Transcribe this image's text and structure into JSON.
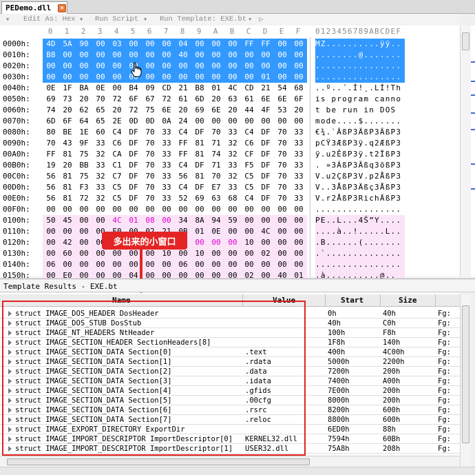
{
  "tab": {
    "title": "PEDemo.dll",
    "close_icon": "x"
  },
  "toolbar": {
    "edit_as": "Edit As: Hex",
    "run_script": "Run Script",
    "run_template": "Run Template: EXE.bt",
    "play_icon": "play-triangle"
  },
  "hex": {
    "columns": [
      "0",
      "1",
      "2",
      "3",
      "4",
      "5",
      "6",
      "7",
      "8",
      "9",
      "A",
      "B",
      "C",
      "D",
      "E",
      "F"
    ],
    "ascii_header": "0123456789ABCDEF",
    "rows": [
      {
        "offset": "0000h:",
        "bytes": [
          "4D",
          "5A",
          "90",
          "00",
          "03",
          "00",
          "00",
          "00",
          "04",
          "00",
          "00",
          "00",
          "FF",
          "FF",
          "00",
          "00"
        ],
        "ascii": "MZ..........ÿÿ.."
      },
      {
        "offset": "0010h:",
        "bytes": [
          "B8",
          "00",
          "00",
          "00",
          "00",
          "00",
          "00",
          "00",
          "40",
          "00",
          "00",
          "00",
          "00",
          "00",
          "00",
          "00"
        ],
        "ascii": ",.......@......."
      },
      {
        "offset": "0020h:",
        "bytes": [
          "00",
          "00",
          "00",
          "00",
          "00",
          "00",
          "00",
          "00",
          "00",
          "00",
          "00",
          "00",
          "00",
          "00",
          "00",
          "00"
        ],
        "ascii": "................"
      },
      {
        "offset": "0030h:",
        "bytes": [
          "00",
          "00",
          "00",
          "00",
          "00",
          "00",
          "00",
          "00",
          "00",
          "00",
          "00",
          "00",
          "00",
          "01",
          "00",
          "00"
        ],
        "ascii": "................"
      },
      {
        "offset": "0040h:",
        "bytes": [
          "0E",
          "1F",
          "BA",
          "0E",
          "00",
          "B4",
          "09",
          "CD",
          "21",
          "B8",
          "01",
          "4C",
          "CD",
          "21",
          "54",
          "68"
        ],
        "ascii": "..º..´.Í!¸.LÍ!Th"
      },
      {
        "offset": "0050h:",
        "bytes": [
          "69",
          "73",
          "20",
          "70",
          "72",
          "6F",
          "67",
          "72",
          "61",
          "6D",
          "20",
          "63",
          "61",
          "6E",
          "6E",
          "6F"
        ],
        "ascii": "is program canno"
      },
      {
        "offset": "0060h:",
        "bytes": [
          "74",
          "20",
          "62",
          "65",
          "20",
          "72",
          "75",
          "6E",
          "20",
          "69",
          "6E",
          "20",
          "44",
          "4F",
          "53",
          "20"
        ],
        "ascii": "t be run in DOS "
      },
      {
        "offset": "0070h:",
        "bytes": [
          "6D",
          "6F",
          "64",
          "65",
          "2E",
          "0D",
          "0D",
          "0A",
          "24",
          "00",
          "00",
          "00",
          "00",
          "00",
          "00",
          "00"
        ],
        "ascii": "mode....$......."
      },
      {
        "offset": "0080h:",
        "bytes": [
          "80",
          "BE",
          "1E",
          "60",
          "C4",
          "DF",
          "70",
          "33",
          "C4",
          "DF",
          "70",
          "33",
          "C4",
          "DF",
          "70",
          "33"
        ],
        "ascii": "€¾.`ÄßP3ÄßP3ÄßP3"
      },
      {
        "offset": "0090h:",
        "bytes": [
          "70",
          "43",
          "9F",
          "33",
          "C6",
          "DF",
          "70",
          "33",
          "FF",
          "81",
          "71",
          "32",
          "C6",
          "DF",
          "70",
          "33"
        ],
        "ascii": "pCŸ3ÆßP3ÿ.q2ÆßP3"
      },
      {
        "offset": "00A0h:",
        "bytes": [
          "FF",
          "81",
          "75",
          "32",
          "CA",
          "DF",
          "70",
          "33",
          "FF",
          "81",
          "74",
          "32",
          "CF",
          "DF",
          "70",
          "33"
        ],
        "ascii": "ÿ.u2ÊßP3ÿ.t2ÏßP3"
      },
      {
        "offset": "00B0h:",
        "bytes": [
          "19",
          "20",
          "BB",
          "33",
          "C1",
          "DF",
          "70",
          "33",
          "C4",
          "DF",
          "71",
          "33",
          "F5",
          "DF",
          "70",
          "33"
        ],
        "ascii": ". »3ÁßP3Äßq3õßP3"
      },
      {
        "offset": "00C0h:",
        "bytes": [
          "56",
          "81",
          "75",
          "32",
          "C7",
          "DF",
          "70",
          "33",
          "56",
          "81",
          "70",
          "32",
          "C5",
          "DF",
          "70",
          "33"
        ],
        "ascii": "V.u2ÇßP3V.p2ÅßP3"
      },
      {
        "offset": "00D0h:",
        "bytes": [
          "56",
          "81",
          "F3",
          "33",
          "C5",
          "DF",
          "70",
          "33",
          "C4",
          "DF",
          "E7",
          "33",
          "C5",
          "DF",
          "70",
          "33"
        ],
        "ascii": "V..3ÅßP3Äßç3ÅßP3"
      },
      {
        "offset": "00E0h:",
        "bytes": [
          "56",
          "81",
          "72",
          "32",
          "C5",
          "DF",
          "70",
          "33",
          "52",
          "69",
          "63",
          "68",
          "C4",
          "DF",
          "70",
          "33"
        ],
        "ascii": "V.r2ÅßP3RichÄßP3"
      },
      {
        "offset": "00F0h:",
        "bytes": [
          "00",
          "00",
          "00",
          "00",
          "00",
          "00",
          "00",
          "00",
          "00",
          "00",
          "00",
          "00",
          "00",
          "00",
          "00",
          "00"
        ],
        "ascii": "................"
      },
      {
        "offset": "0100h:",
        "bytes": [
          "50",
          "45",
          "00",
          "00",
          "4C",
          "01",
          "08",
          "00",
          "34",
          "8A",
          "94",
          "59",
          "00",
          "00",
          "00",
          "00"
        ],
        "ascii": "PE..L...4Š”Y...."
      },
      {
        "offset": "0110h:",
        "bytes": [
          "00",
          "00",
          "00",
          "00",
          "E0",
          "00",
          "02",
          "21",
          "0B",
          "01",
          "0E",
          "00",
          "00",
          "4C",
          "00",
          "00"
        ],
        "ascii": "....à..!.....L.."
      },
      {
        "offset": "0120h:",
        "bytes": [
          "00",
          "42",
          "00",
          "00",
          "00",
          "00",
          "00",
          "00",
          "10",
          "00",
          "00",
          "00",
          "10",
          "00",
          "00",
          "00"
        ],
        "ascii": ".B......(......."
      },
      {
        "offset": "0130h:",
        "bytes": [
          "00",
          "60",
          "00",
          "00",
          "00",
          "00",
          "00",
          "10",
          "00",
          "10",
          "00",
          "00",
          "00",
          "02",
          "00",
          "00"
        ],
        "ascii": ".`.............."
      },
      {
        "offset": "0140h:",
        "bytes": [
          "06",
          "00",
          "00",
          "00",
          "00",
          "00",
          "00",
          "00",
          "06",
          "00",
          "00",
          "00",
          "00",
          "00",
          "00",
          "00"
        ],
        "ascii": "................"
      },
      {
        "offset": "0150h:",
        "bytes": [
          "00",
          "E0",
          "00",
          "00",
          "00",
          "04",
          "00",
          "00",
          "00",
          "00",
          "00",
          "00",
          "02",
          "00",
          "40",
          "01"
        ],
        "ascii": ".à..........@.."
      }
    ]
  },
  "annotation": {
    "callout_text": "多出来的小窗口"
  },
  "template_panel": {
    "title": "Template Results - EXE.bt",
    "headers": {
      "name": "Name",
      "value": "Value",
      "start": "Start",
      "size": "Size"
    },
    "rows": [
      {
        "name": "struct IMAGE_DOS_HEADER DosHeader",
        "value": "",
        "start": "0h",
        "size": "40h",
        "extra": "Fg:"
      },
      {
        "name": "struct IMAGE_DOS_STUB DosStub",
        "value": "",
        "start": "40h",
        "size": "C0h",
        "extra": "Fg:"
      },
      {
        "name": "struct IMAGE_NT_HEADERS NtHeader",
        "value": "",
        "start": "100h",
        "size": "F8h",
        "extra": "Fg:"
      },
      {
        "name": "struct IMAGE_SECTION_HEADER SectionHeaders[8]",
        "value": "",
        "start": "1F8h",
        "size": "140h",
        "extra": "Fg:"
      },
      {
        "name": "struct IMAGE_SECTION_DATA Section[0]",
        "value": ".text",
        "start": "400h",
        "size": "4C00h",
        "extra": "Fg:"
      },
      {
        "name": "struct IMAGE_SECTION_DATA Section[1]",
        "value": ".rdata",
        "start": "5000h",
        "size": "2200h",
        "extra": "Fg:"
      },
      {
        "name": "struct IMAGE_SECTION_DATA Section[2]",
        "value": ".data",
        "start": "7200h",
        "size": "200h",
        "extra": "Fg:"
      },
      {
        "name": "struct IMAGE_SECTION_DATA Section[3]",
        "value": ".idata",
        "start": "7400h",
        "size": "A00h",
        "extra": "Fg:"
      },
      {
        "name": "struct IMAGE_SECTION_DATA Section[4]",
        "value": ".gfids",
        "start": "7E00h",
        "size": "200h",
        "extra": "Fg:"
      },
      {
        "name": "struct IMAGE_SECTION_DATA Section[5]",
        "value": ".00cfg",
        "start": "8000h",
        "size": "200h",
        "extra": "Fg:"
      },
      {
        "name": "struct IMAGE_SECTION_DATA Section[6]",
        "value": ".rsrc",
        "start": "8200h",
        "size": "600h",
        "extra": "Fg:"
      },
      {
        "name": "struct IMAGE_SECTION_DATA Section[7]",
        "value": ".reloc",
        "start": "8800h",
        "size": "600h",
        "extra": "Fg:"
      },
      {
        "name": "struct IMAGE_EXPORT_DIRECTORY ExportDir",
        "value": "",
        "start": "6ED0h",
        "size": "88h",
        "extra": "Fg:"
      },
      {
        "name": "struct IMAGE_IMPORT_DESCRIPTOR ImportDescriptor[0]",
        "value": "KERNEL32.dll",
        "start": "7594h",
        "size": "60Bh",
        "extra": "Fg:"
      },
      {
        "name": "struct IMAGE_IMPORT_DESCRIPTOR ImportDescriptor[1]",
        "value": "USER32.dll",
        "start": "75A8h",
        "size": "208h",
        "extra": "Fg:"
      }
    ]
  },
  "colors": {
    "selection": "#3399ff",
    "pe_header_bg": "#fbe4f7",
    "callout": "#e42424"
  }
}
